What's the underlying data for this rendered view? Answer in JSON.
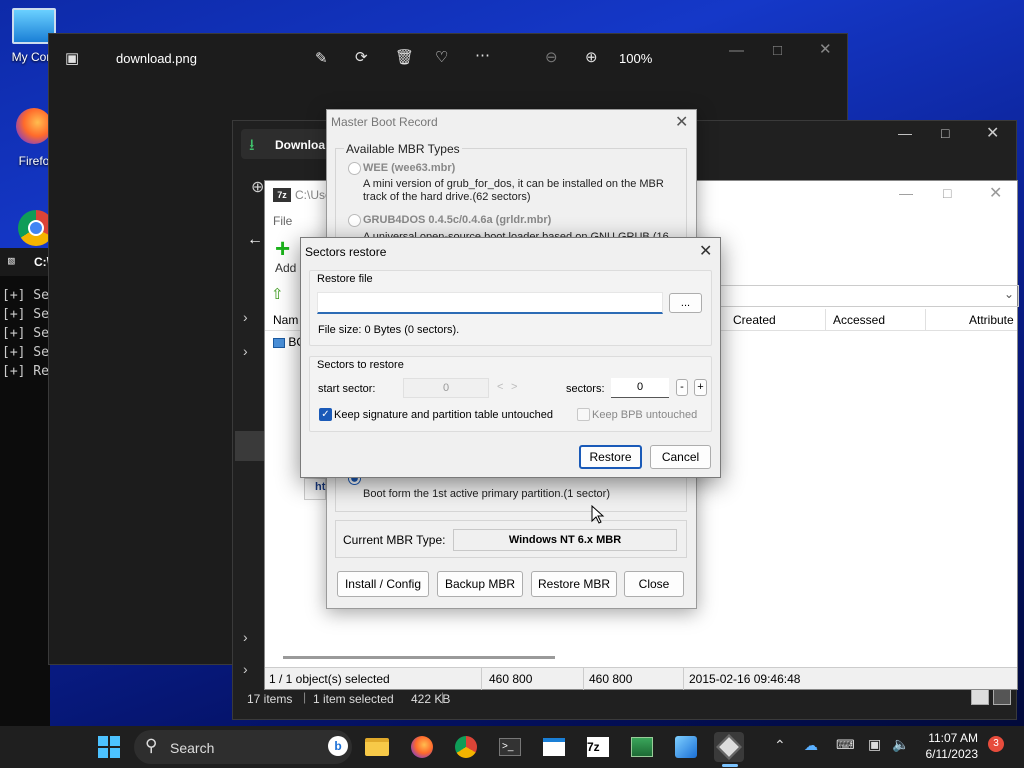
{
  "desktop": {
    "icons": [
      {
        "label": "My Com"
      },
      {
        "label": "Firefo"
      }
    ]
  },
  "console": {
    "title": "C:\\",
    "lines": [
      "[+] Se",
      "[+] Se",
      "[+] Se",
      "[+] Se",
      "[+] Re"
    ]
  },
  "photos": {
    "filename": "download.png",
    "zoom": "100%"
  },
  "download_manager": {
    "title": "Downloa"
  },
  "sevenzip": {
    "title": "C:\\Use",
    "menu_file": "File",
    "add_label": "Add",
    "columns": [
      "Nam",
      "Created",
      "Accessed",
      "Attribute"
    ],
    "row_name": "BO",
    "status": {
      "selected": "1 / 1 object(s) selected",
      "size1": "460 800",
      "size2": "460 800",
      "date": "2015-02-16 09:46:48"
    },
    "footer": {
      "items": "17 items",
      "selected": "1 item selected",
      "size": "422 KB"
    }
  },
  "mbr": {
    "title": "Master Boot Record",
    "group_label": "Available MBR Types",
    "option1_title": "WEE (wee63.mbr)",
    "option1_desc1": "A mini version of grub_for_dos, it can be installed on the MBR",
    "option1_desc2": "track of the hard drive.(62 sectors)",
    "option2_title": "GRUB4DOS 0.4.5c/0.4.6a (grldr.mbr)",
    "option2_desc": "A universal open-source boot loader based on GNU GRUB (16",
    "option3_desc": "Boot form the 1st active primary partition.(1 sector)",
    "link_fragment": "ht",
    "current_label": "Current MBR Type:",
    "current_value": "Windows NT 6.x MBR",
    "buttons": {
      "install": "Install / Config",
      "backup": "Backup MBR",
      "restore": "Restore MBR",
      "close": "Close"
    }
  },
  "sectors_restore": {
    "title": "Sectors restore",
    "restore_file_label": "Restore file",
    "file_input_value": "",
    "browse_label": "...",
    "file_size": "File size: 0 Bytes (0 sectors).",
    "sectors_group_label": "Sectors to restore",
    "start_sector_label": "start sector:",
    "start_sector_value": "0",
    "prev_label": "<",
    "next_label": ">",
    "sectors_label": "sectors:",
    "sectors_value": "0",
    "minus_label": "-",
    "plus_label": "+",
    "keep_signature_label": "Keep signature and partition table untouched",
    "keep_signature_checked": true,
    "keep_bpb_label": "Keep BPB untouched",
    "keep_bpb_checked": false,
    "restore_button": "Restore",
    "cancel_button": "Cancel"
  },
  "taskbar": {
    "search_placeholder": "Search",
    "time": "11:07 AM",
    "date": "6/11/2023",
    "notification_count": "3"
  }
}
